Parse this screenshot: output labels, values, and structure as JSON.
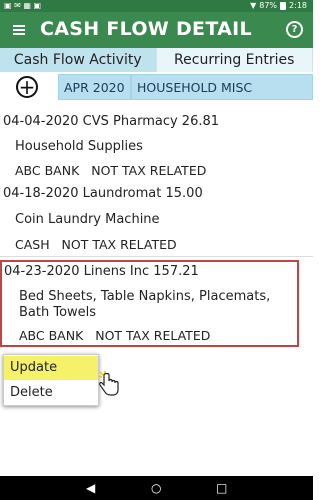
{
  "status": {
    "time": "2:18",
    "battery": "87%"
  },
  "appbar": {
    "title": "CASH FLOW DETAIL",
    "menu_icon": "hamburger-icon",
    "help_icon": "help-icon"
  },
  "tabs": [
    {
      "label": "Cash Flow Activity",
      "active": true
    },
    {
      "label": "Recurring Entries",
      "active": false
    }
  ],
  "filters": {
    "add_icon": "plus-circle-icon",
    "month": "APR 2020",
    "category": "HOUSEHOLD MISC"
  },
  "entries": [
    {
      "line1": "04-04-2020  CVS Pharmacy  26.81",
      "description": "Household Supplies",
      "bank": "ABC BANK",
      "tax": "NOT TAX RELATED"
    },
    {
      "line1": "04-18-2020  Laundromat  15.00",
      "description": "Coin Laundry Machine",
      "bank": "CASH",
      "tax": "NOT TAX RELATED"
    },
    {
      "line1": "04-23-2020  Linens Inc  157.21",
      "description": "Bed Sheets, Table Napkins, Placemats, Bath Towels",
      "bank": "ABC BANK",
      "tax": "NOT TAX RELATED"
    }
  ],
  "context_menu": {
    "update": "Update",
    "delete": "Delete"
  },
  "nav": {
    "back_icon": "back-icon",
    "home_icon": "home-icon",
    "recents_icon": "recents-icon"
  }
}
